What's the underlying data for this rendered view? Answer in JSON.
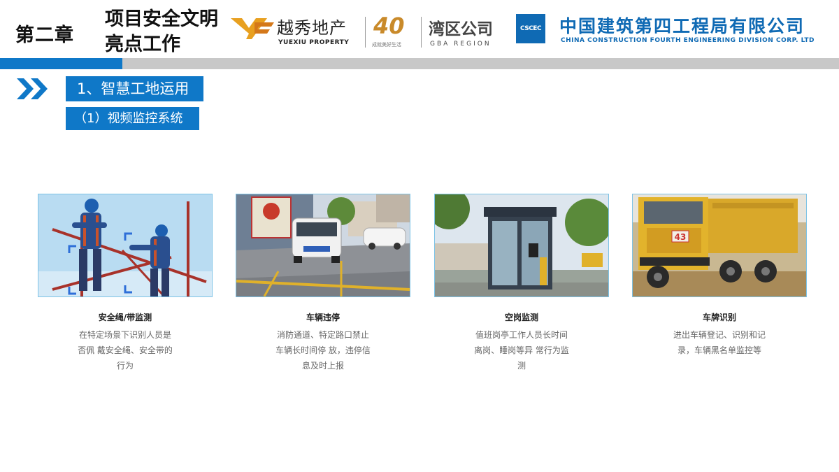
{
  "header": {
    "chapter": "第二章",
    "chapter_title": "项目安全文明亮点工作",
    "yuexiu_cn": "越秀地产",
    "yuexiu_en": "YUEXIU PROPERTY",
    "anniv_number": "40",
    "anniv_slogan": "成就美好生活",
    "gba_cn": "湾区公司",
    "gba_en": "GBA REGION",
    "cscec_mark": "CSCEC",
    "cscec_cn": "中国建筑第四工程局有限公司",
    "cscec_en": "CHINA CONSTRUCTION FOURTH ENGINEERING DIVISION CORP. LTD"
  },
  "section": {
    "title": "1、智慧工地运用",
    "subtitle": "（1）视频监控系统"
  },
  "cards": [
    {
      "title": "安全绳/带监测",
      "desc": "在特定场景下识别人员是否佩 戴安全绳、安全带的行为"
    },
    {
      "title": "车辆违停",
      "desc": "消防通道、特定路口禁止车辆长时间停 放，违停信息及时上报"
    },
    {
      "title": "空岗监测",
      "desc": "值班岗亭工作人员长时间离岗、睡岗等异 常行为监测"
    },
    {
      "title": "车牌识别",
      "desc": "进出车辆登记、识别和记录，车辆黑名单监控等",
      "plate": "43"
    }
  ],
  "colors": {
    "brand_blue": "#0f78c8",
    "cscec_blue": "#0f6ab4",
    "band_gray": "#c8c8c8",
    "yuexiu_orange": "#e8a020"
  }
}
